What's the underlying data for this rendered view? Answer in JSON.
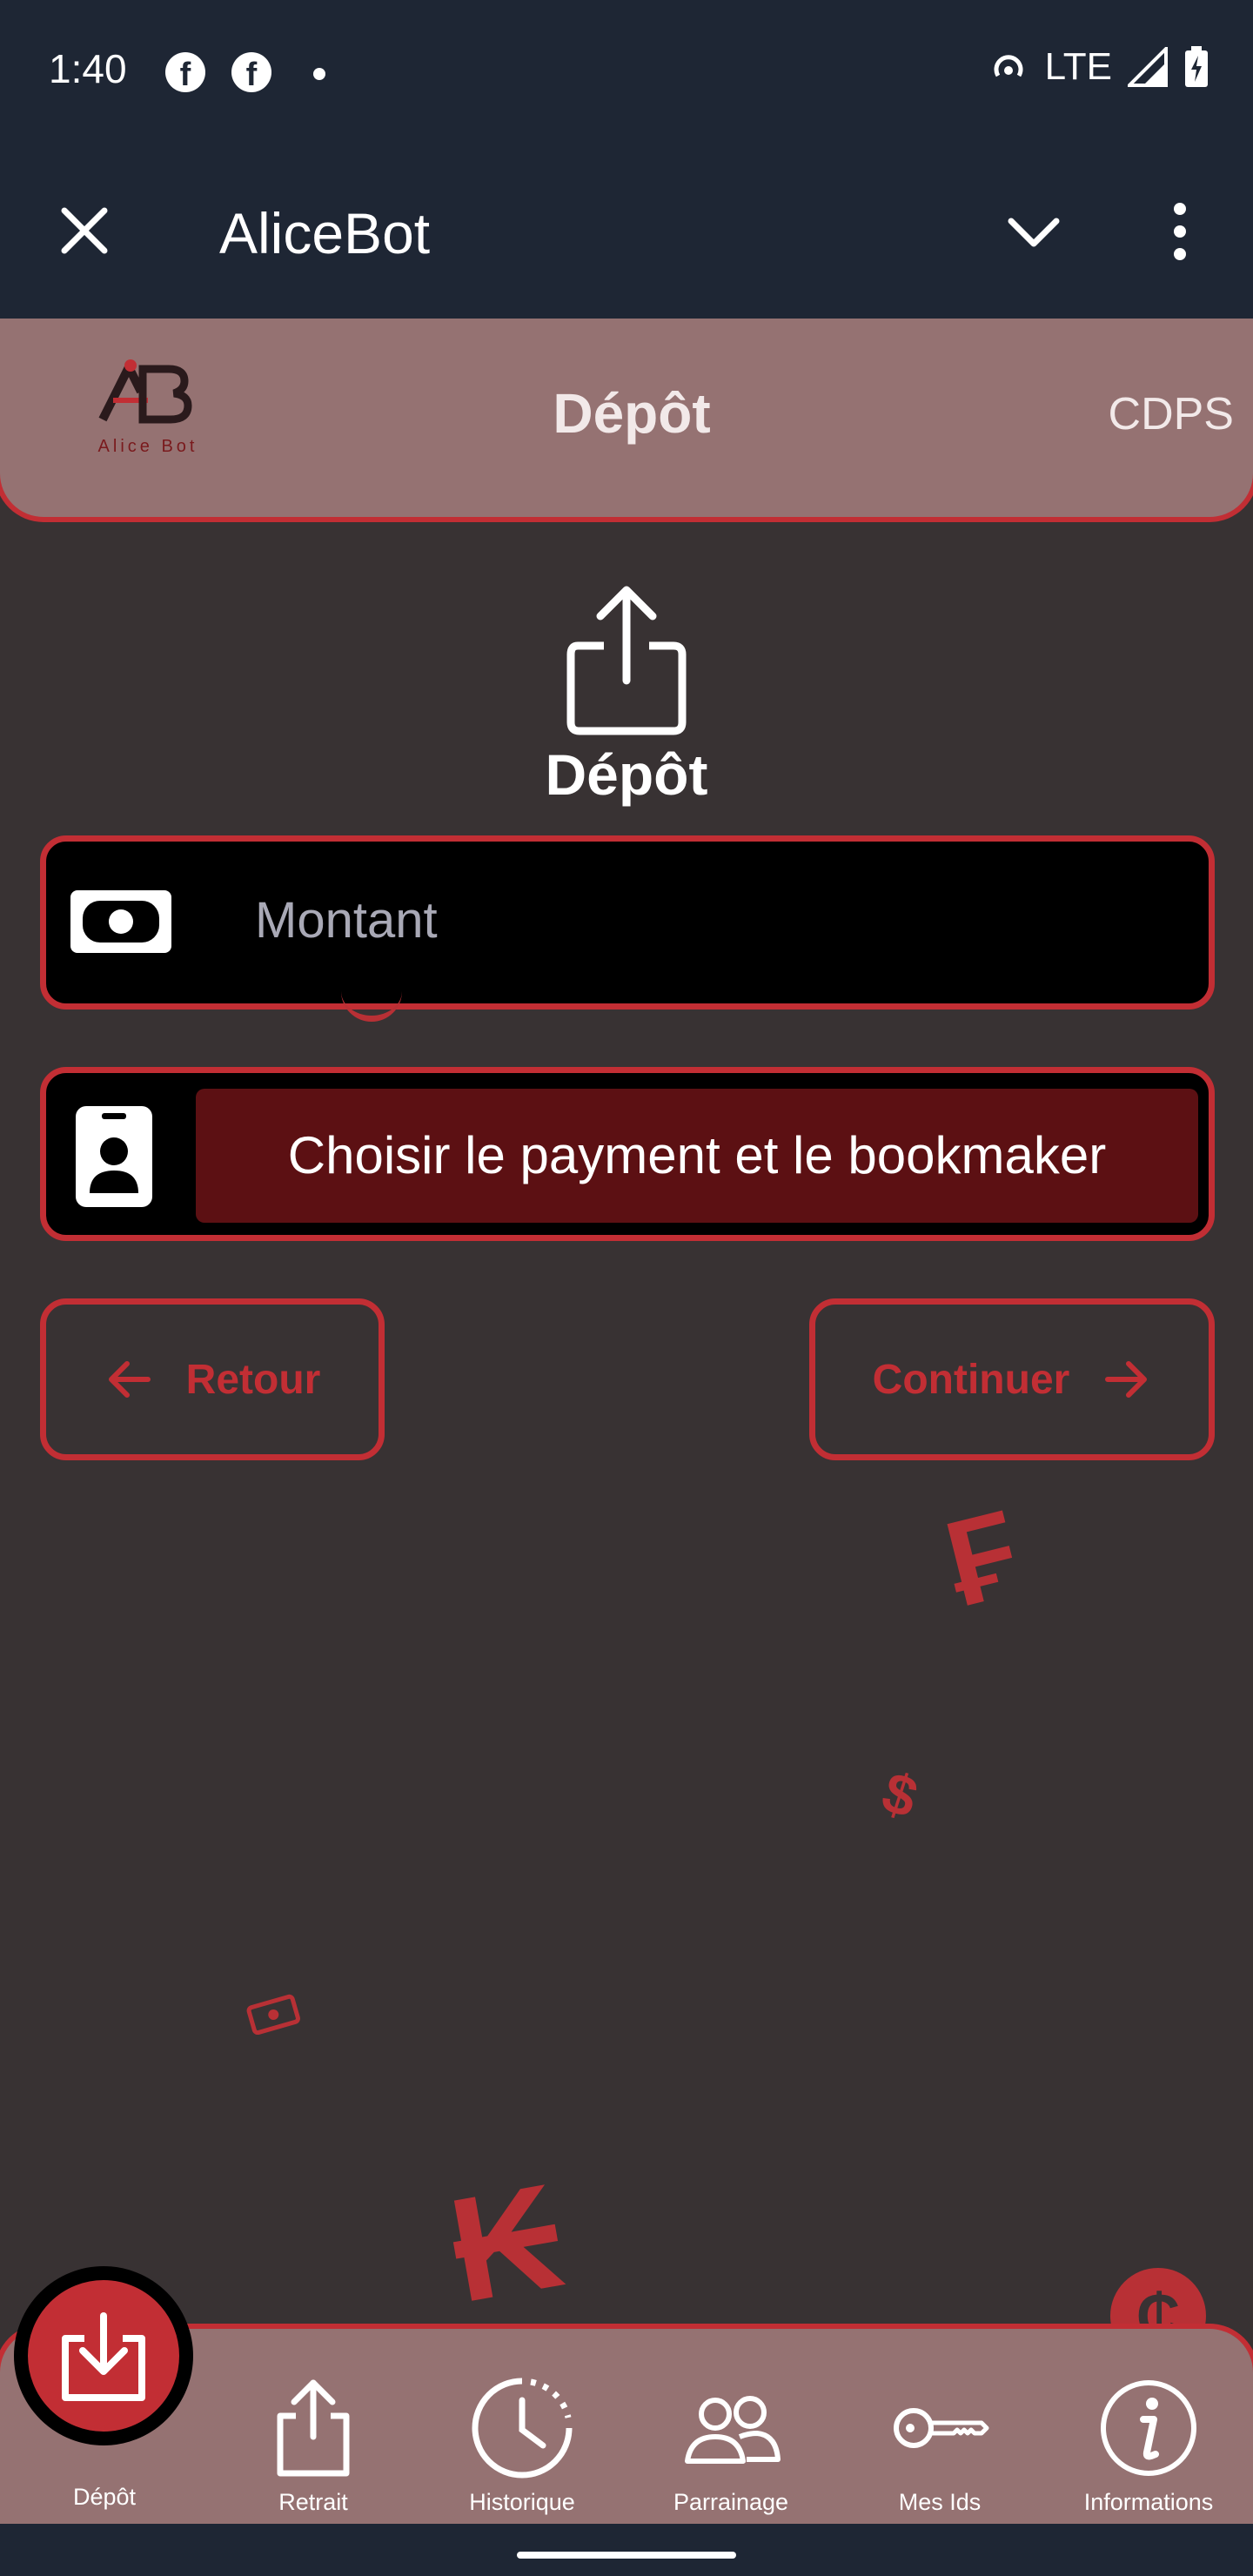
{
  "status_bar": {
    "time": "1:40",
    "network": "LTE",
    "facebook_glyph": "f"
  },
  "app_bar": {
    "title": "AliceBot"
  },
  "header": {
    "logo_text": "Alice Bot",
    "title": "Dépôt",
    "right_label": "CDPS"
  },
  "form": {
    "title": "Dépôt",
    "amount_placeholder": "Montant",
    "amount_value": "",
    "payment_select_label": "Choisir le payment et le bookmaker",
    "back_label": "Retour",
    "continue_label": "Continuer"
  },
  "decorations": {
    "symbols": [
      "₣",
      "$",
      "₭",
      "₵"
    ]
  },
  "bottom_nav": {
    "items": [
      {
        "label": "Dépôt",
        "icon": "download-icon",
        "active": true
      },
      {
        "label": "Retrait",
        "icon": "upload-icon",
        "active": false
      },
      {
        "label": "Historique",
        "icon": "clock-icon",
        "active": false
      },
      {
        "label": "Parrainage",
        "icon": "people-icon",
        "active": false
      },
      {
        "label": "Mes Ids",
        "icon": "key-icon",
        "active": false
      },
      {
        "label": "Informations",
        "icon": "info-icon",
        "active": false
      }
    ]
  },
  "colors": {
    "accent": "#c22e34",
    "background": "#383233",
    "card": "#957272",
    "bar": "#1e2634"
  }
}
